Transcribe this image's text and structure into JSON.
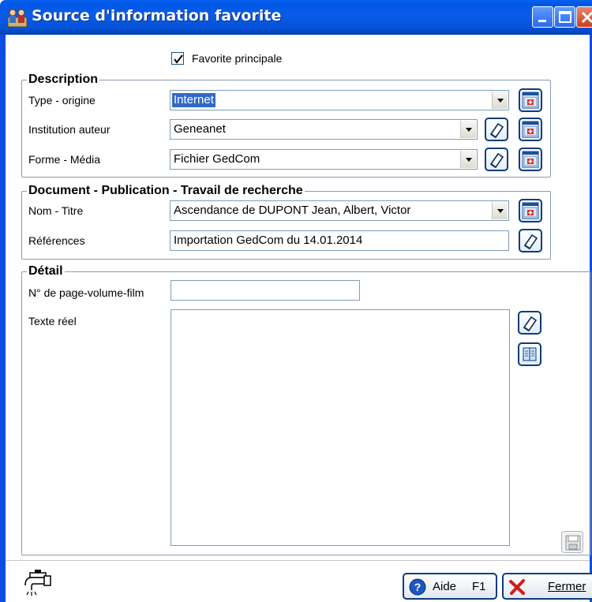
{
  "window": {
    "title": "Source d'information favorite"
  },
  "favorite": {
    "label": "Favorite principale",
    "checked": true
  },
  "description": {
    "legend": "Description",
    "type_label": "Type - origine",
    "type_value": "Internet",
    "institution_label": "Institution auteur",
    "institution_value": "Geneanet",
    "forme_label": "Forme - Média",
    "forme_value": "Fichier GedCom"
  },
  "document": {
    "legend": "Document - Publication - Travail de recherche",
    "nom_label": "Nom - Titre",
    "nom_value": "Ascendance de DUPONT Jean, Albert, Victor",
    "ref_label": "Références",
    "ref_value": "Importation GedCom du 14.01.2014"
  },
  "detail": {
    "legend": "Détail",
    "page_label": "N° de page-volume-film",
    "page_value": "",
    "texte_label": "Texte réel",
    "texte_value": ""
  },
  "footer": {
    "aide_label": "Aide",
    "aide_key": "F1",
    "fermer_label": "Fermer"
  },
  "icons": {
    "app": "people-icon",
    "list": "list-form-icon",
    "eraser": "eraser-icon",
    "book": "book-icon",
    "save": "floppy-disk-icon",
    "tap": "tap-faucet-icon",
    "help": "help-icon",
    "close": "red-x-icon"
  },
  "colors": {
    "titlebar": "#0058e6",
    "selection": "#316ac5",
    "button_border": "#0b3d7a"
  }
}
